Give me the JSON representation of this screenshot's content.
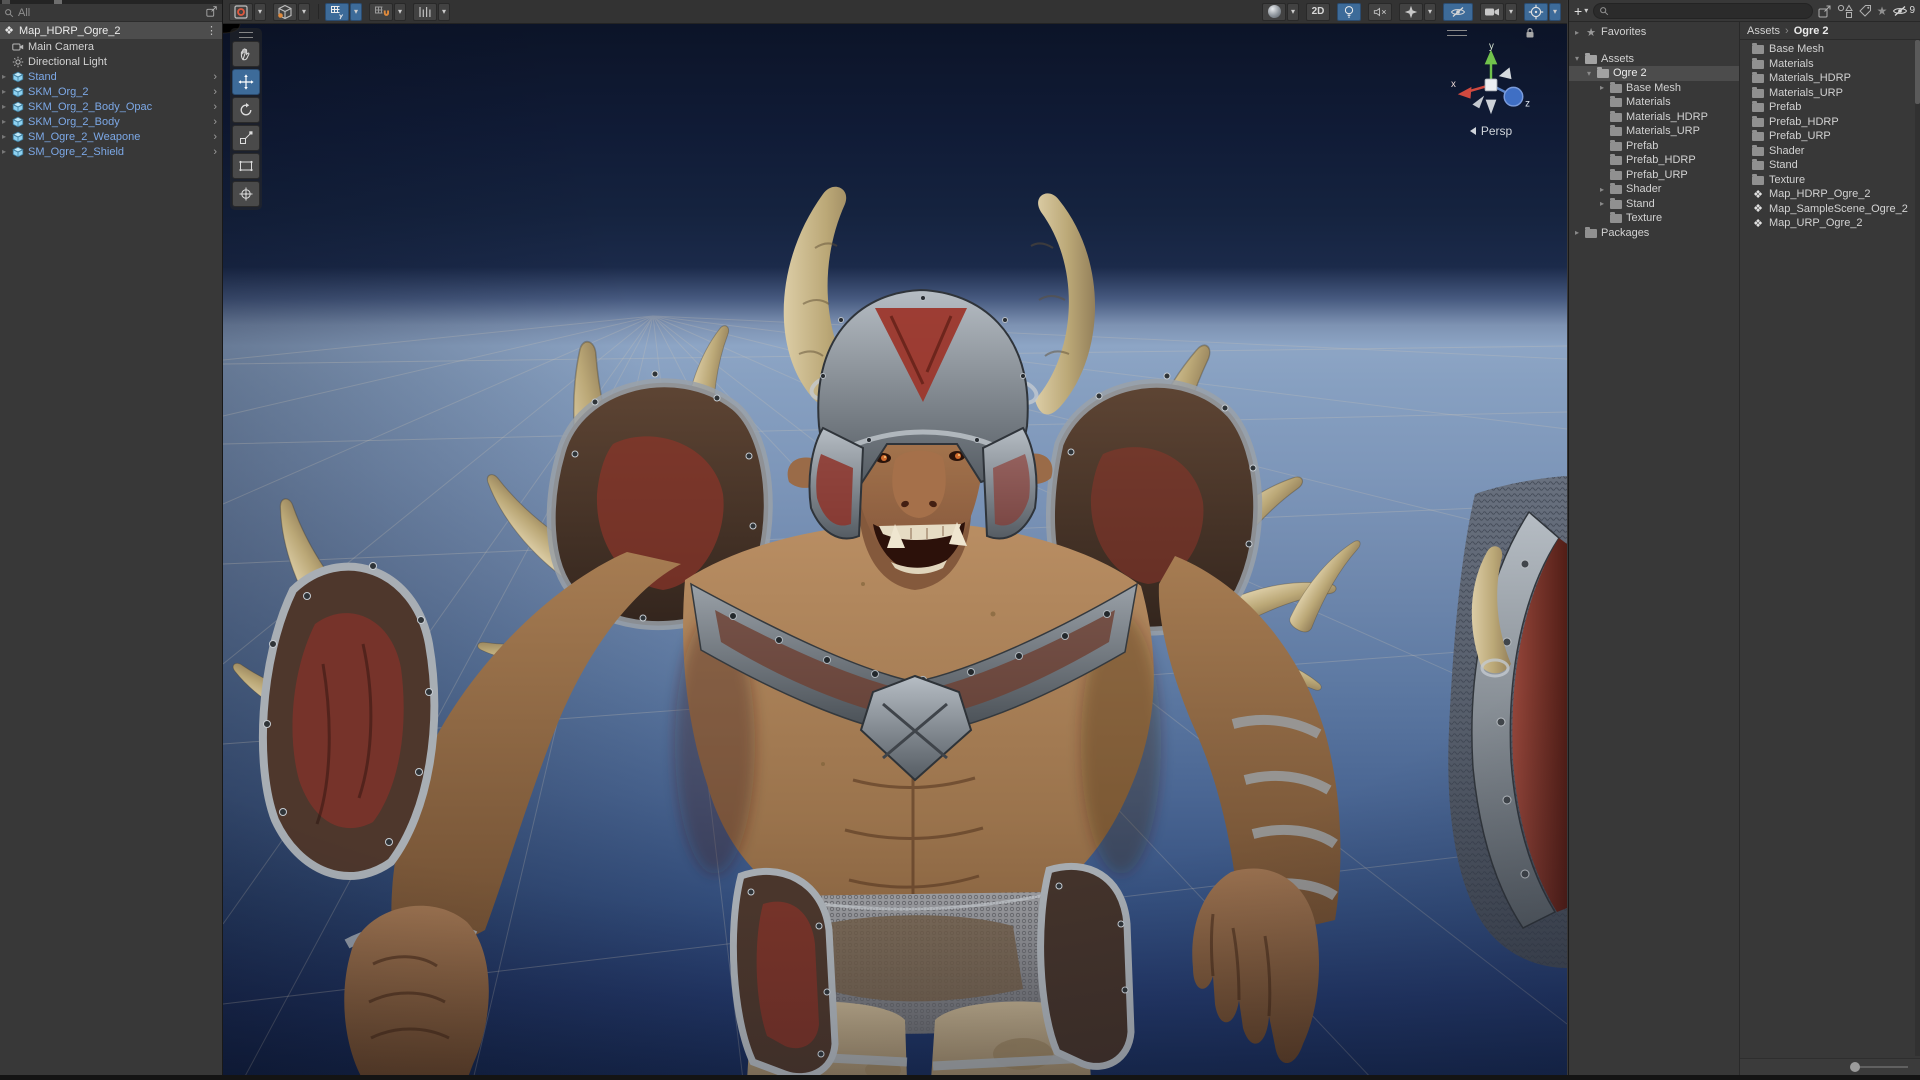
{
  "icons": {
    "dropdown": "▾",
    "collapsed": "▸",
    "expanded": "▾",
    "chevron": "›",
    "kebab": "⋮",
    "star": "★",
    "unity": "❖",
    "plus": "+",
    "breadcrumb_sep": "›"
  },
  "hierarchy": {
    "filter_label": "All",
    "scene": {
      "label": "Map_HDRP_Ogre_2"
    },
    "items": [
      {
        "label": "Main Camera",
        "icon": "camera"
      },
      {
        "label": "Directional Light",
        "icon": "light"
      },
      {
        "label": "Stand",
        "icon": "prefab"
      },
      {
        "label": "SKM_Org_2",
        "icon": "prefab"
      },
      {
        "label": "SKM_Org_2_Body_Opac",
        "icon": "prefab"
      },
      {
        "label": "SKM_Org_2_Body",
        "icon": "prefab"
      },
      {
        "label": "SM_Ogre_2_Weapone",
        "icon": "prefab"
      },
      {
        "label": "SM_Ogre_2_Shield",
        "icon": "prefab"
      }
    ]
  },
  "scene_toolbar": {
    "mode_2d": "2D"
  },
  "scene_view": {
    "projection": "Persp",
    "axes": {
      "x": "x",
      "y": "y",
      "z": "z"
    }
  },
  "tools": {
    "items": [
      "hand-tool",
      "move-tool",
      "rotate-tool",
      "scale-tool",
      "rect-tool",
      "transform-tool"
    ],
    "active": "move-tool"
  },
  "project": {
    "add_label": "+",
    "hidden_count": "9",
    "breadcrumb": {
      "root": "Assets",
      "current": "Ogre 2"
    },
    "tree": [
      {
        "label": "Favorites"
      },
      {
        "label": "Assets"
      },
      {
        "label": "Ogre 2"
      },
      {
        "label": "Base Mesh"
      },
      {
        "label": "Materials"
      },
      {
        "label": "Materials_HDRP"
      },
      {
        "label": "Materials_URP"
      },
      {
        "label": "Prefab"
      },
      {
        "label": "Prefab_HDRP"
      },
      {
        "label": "Prefab_URP"
      },
      {
        "label": "Shader"
      },
      {
        "label": "Stand"
      },
      {
        "label": "Texture"
      },
      {
        "label": "Packages"
      }
    ],
    "files": [
      {
        "label": "Base Mesh",
        "icon": "folder"
      },
      {
        "label": "Materials",
        "icon": "folder"
      },
      {
        "label": "Materials_HDRP",
        "icon": "folder"
      },
      {
        "label": "Materials_URP",
        "icon": "folder"
      },
      {
        "label": "Prefab",
        "icon": "folder"
      },
      {
        "label": "Prefab_HDRP",
        "icon": "folder"
      },
      {
        "label": "Prefab_URP",
        "icon": "folder"
      },
      {
        "label": "Shader",
        "icon": "folder"
      },
      {
        "label": "Stand",
        "icon": "folder"
      },
      {
        "label": "Texture",
        "icon": "folder"
      },
      {
        "label": "Map_HDRP_Ogre_2",
        "icon": "scene"
      },
      {
        "label": "Map_SampleScene_Ogre_2",
        "icon": "scene"
      },
      {
        "label": "Map_URP_Ogre_2",
        "icon": "scene"
      }
    ]
  },
  "colors": {
    "accent_blue": "#3D6B99",
    "selection_gray": "#4C4C4C",
    "prefab_text": "#7CA8E6",
    "panel_bg": "#383838"
  }
}
